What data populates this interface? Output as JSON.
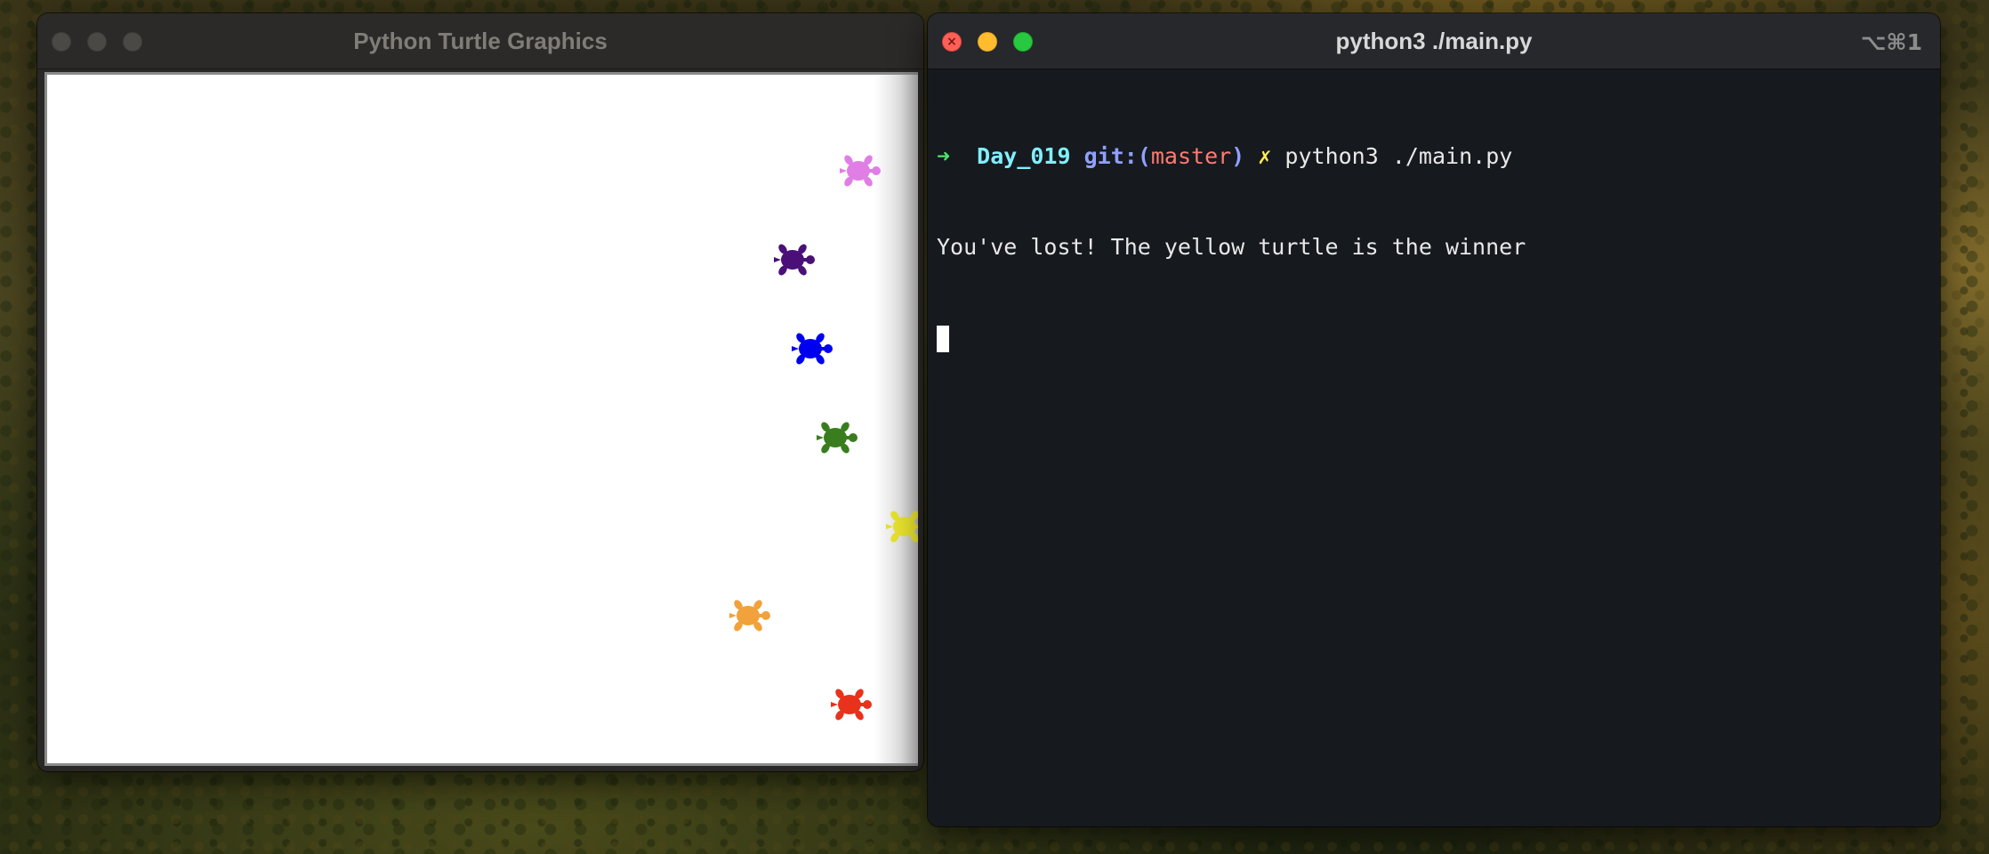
{
  "turtle_window": {
    "title": "Python Turtle Graphics",
    "turtles": [
      {
        "color": "#e07ee6",
        "name": "violet"
      },
      {
        "color": "#4a1078",
        "name": "indigo"
      },
      {
        "color": "#0000f0",
        "name": "blue"
      },
      {
        "color": "#3a7d1e",
        "name": "green"
      },
      {
        "color": "#e6e02e",
        "name": "yellow"
      },
      {
        "color": "#f1a23a",
        "name": "orange"
      },
      {
        "color": "#e8321c",
        "name": "red"
      }
    ]
  },
  "terminal_window": {
    "title": "python3 ./main.py",
    "shortcut": "⌥⌘1",
    "prompt": {
      "arrow": "➜",
      "directory": "Day_019",
      "git_label": "git:(",
      "branch": "master",
      "git_close": ")",
      "dirty_marker": "✗",
      "command": "python3 ./main.py"
    },
    "output": "You've lost! The yellow turtle is the winner"
  },
  "colors": {
    "close": "#fe5f57",
    "minimize": "#febc2e",
    "maximize": "#28c840",
    "terminal_bg": "#16191e"
  }
}
